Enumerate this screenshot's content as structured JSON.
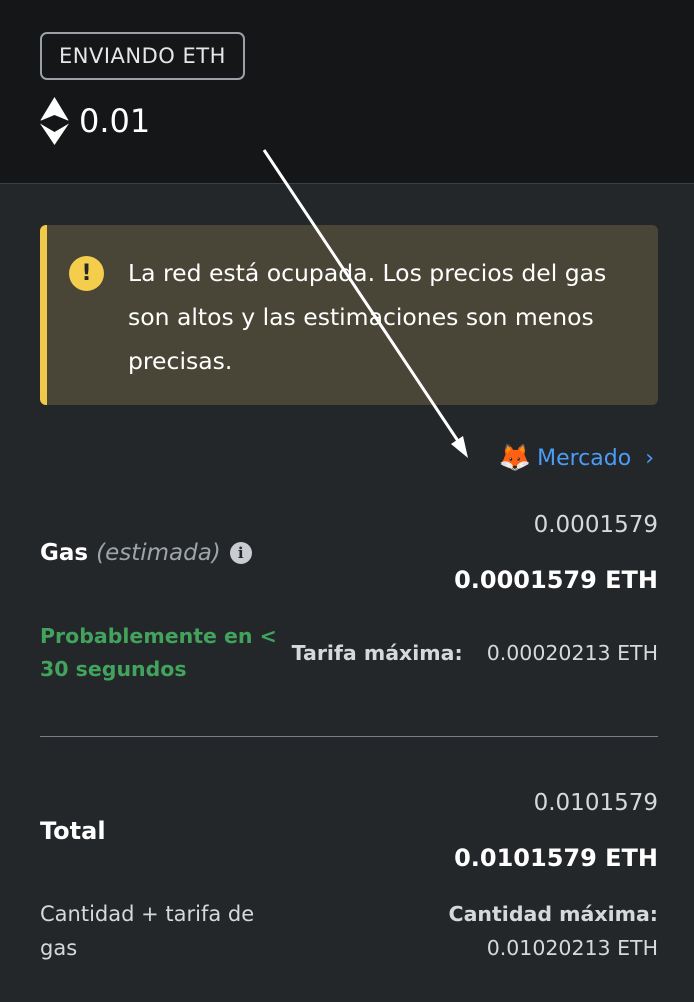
{
  "header": {
    "badge": "ENVIANDO ETH",
    "amount": "0.01",
    "currency_icon": "ethereum-icon"
  },
  "alert": {
    "icon": "warning-icon",
    "text": "La red está ocupada. Los precios del gas son altos y las estimaciones son menos precisas.",
    "accent_color": "#f0c94a"
  },
  "market": {
    "icon": "metamask-fox-icon",
    "label": "Mercado",
    "chevron": "›",
    "color": "#4a9cf6"
  },
  "gas": {
    "label": "Gas",
    "estimated": "(estimada)",
    "info_icon": "info-icon",
    "value": "0.0001579",
    "value_eth": "0.0001579 ETH",
    "likely": "Probablemente en < 30 segundos",
    "likely_color": "#41a35c",
    "max_fee_label": "Tarifa máxima:",
    "max_fee_value": "0.00020213 ETH"
  },
  "total": {
    "label": "Total",
    "value": "0.0101579",
    "value_eth": "0.0101579 ETH",
    "sub_label": "Cantidad + tarifa de gas",
    "max_amount_label": "Cantidad máxima:",
    "max_amount_value": "0.01020213 ETH"
  }
}
